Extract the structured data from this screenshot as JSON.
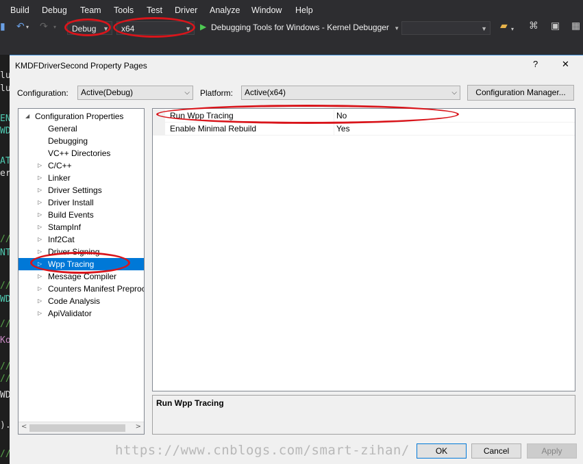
{
  "menu": [
    "Build",
    "Debug",
    "Team",
    "Tools",
    "Test",
    "Driver",
    "Analyze",
    "Window",
    "Help"
  ],
  "toolbar": {
    "configuration": "Debug",
    "platform": "x64",
    "debugger": "Debugging Tools for Windows - Kernel Debugger"
  },
  "dialog": {
    "title": "KMDFDriverSecond Property Pages",
    "help_label": "?",
    "close_label": "✕",
    "configuration_label": "Configuration:",
    "configuration_value": "Active(Debug)",
    "platform_label": "Platform:",
    "platform_value": "Active(x64)",
    "config_manager_button": "Configuration Manager...",
    "tree": [
      {
        "label": "Configuration Properties",
        "level": 0,
        "expander": "◢",
        "selected": false
      },
      {
        "label": "General",
        "level": 1,
        "expander": "",
        "selected": false
      },
      {
        "label": "Debugging",
        "level": 1,
        "expander": "",
        "selected": false
      },
      {
        "label": "VC++ Directories",
        "level": 1,
        "expander": "",
        "selected": false
      },
      {
        "label": "C/C++",
        "level": 1,
        "expander": "▷",
        "selected": false
      },
      {
        "label": "Linker",
        "level": 1,
        "expander": "▷",
        "selected": false
      },
      {
        "label": "Driver Settings",
        "level": 1,
        "expander": "▷",
        "selected": false
      },
      {
        "label": "Driver Install",
        "level": 1,
        "expander": "▷",
        "selected": false
      },
      {
        "label": "Build Events",
        "level": 1,
        "expander": "▷",
        "selected": false
      },
      {
        "label": "StampInf",
        "level": 1,
        "expander": "▷",
        "selected": false
      },
      {
        "label": "Inf2Cat",
        "level": 1,
        "expander": "▷",
        "selected": false
      },
      {
        "label": "Driver Signing",
        "level": 1,
        "expander": "▷",
        "selected": false
      },
      {
        "label": "Wpp Tracing",
        "level": 1,
        "expander": "▷",
        "selected": true
      },
      {
        "label": "Message Compiler",
        "level": 1,
        "expander": "▷",
        "selected": false
      },
      {
        "label": "Counters Manifest Preproc",
        "level": 1,
        "expander": "▷",
        "selected": false
      },
      {
        "label": "Code Analysis",
        "level": 1,
        "expander": "▷",
        "selected": false
      },
      {
        "label": "ApiValidator",
        "level": 1,
        "expander": "▷",
        "selected": false
      }
    ],
    "properties": [
      {
        "name": "Run Wpp Tracing",
        "value": "No"
      },
      {
        "name": "Enable Minimal Rebuild",
        "value": "Yes"
      }
    ],
    "description_title": "Run Wpp Tracing",
    "ok_button": "OK",
    "cancel_button": "Cancel",
    "apply_button": "Apply"
  },
  "watermark": "https://www.cnblogs.com/smart-zihan/",
  "code_fragments": [
    {
      "text": "lu",
      "color": "#dcdcdc"
    },
    {
      "text": "lu",
      "color": "#dcdcdc"
    },
    {
      "text": "EN",
      "color": "#4ec9b0"
    },
    {
      "text": "WD",
      "color": "#4ec9b0"
    },
    {
      "text": "AT",
      "color": "#4ec9b0"
    },
    {
      "text": "er",
      "color": "#dcdcdc"
    },
    {
      "text": "//",
      "color": "#57a64a"
    },
    {
      "text": "NT",
      "color": "#4ec9b0"
    },
    {
      "text": "//",
      "color": "#57a64a"
    },
    {
      "text": "WD",
      "color": "#4ec9b0"
    },
    {
      "text": "//",
      "color": "#57a64a"
    },
    {
      "text": "Ko",
      "color": "#c586c0"
    },
    {
      "text": "//",
      "color": "#57a64a"
    },
    {
      "text": "//",
      "color": "#57a64a"
    },
    {
      "text": "WD",
      "color": "#dcdcdc"
    },
    {
      "text": ").",
      "color": "#dcdcdc"
    },
    {
      "text": "//",
      "color": "#57a64a"
    }
  ],
  "colors": {
    "annotation": "#d9151b",
    "selection": "#0078d7",
    "vs_chrome": "#2d2d30"
  }
}
